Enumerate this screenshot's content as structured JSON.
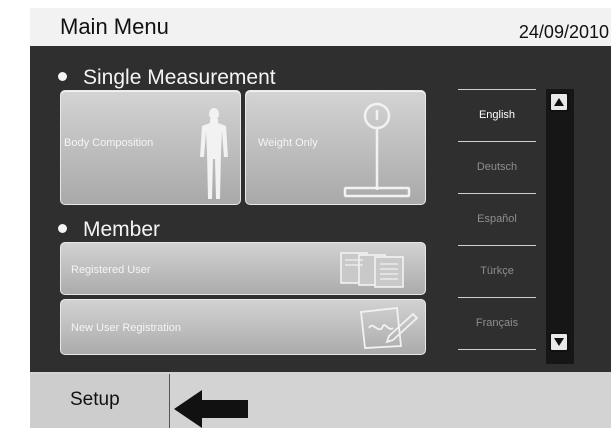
{
  "header": {
    "title": "Main Menu",
    "date": "24/09/2010"
  },
  "single": {
    "heading": "Single Measurement",
    "body_label": "Body Composition",
    "weight_label": "Weight Only"
  },
  "member": {
    "heading": "Member",
    "registered_label": "Registered User",
    "new_label": "New User Registration"
  },
  "languages": [
    {
      "label": "English",
      "selected": true
    },
    {
      "label": "Deutsch",
      "selected": false
    },
    {
      "label": "Español",
      "selected": false
    },
    {
      "label": "Türkçe",
      "selected": false
    },
    {
      "label": "Français",
      "selected": false
    }
  ],
  "footer": {
    "setup_label": "Setup"
  },
  "icons": {
    "body": "human-figure-icon",
    "scale": "scale-icon",
    "docs": "documents-icon",
    "register": "clipboard-pen-icon",
    "up": "arrow-up-icon",
    "down": "arrow-down-icon",
    "pointer": "arrow-left-icon"
  },
  "colors": {
    "panel": "#2f2f2f",
    "tile": "#bcbcbc",
    "selected_text": "#ffffff",
    "unselected_text": "#9a9a9a"
  }
}
